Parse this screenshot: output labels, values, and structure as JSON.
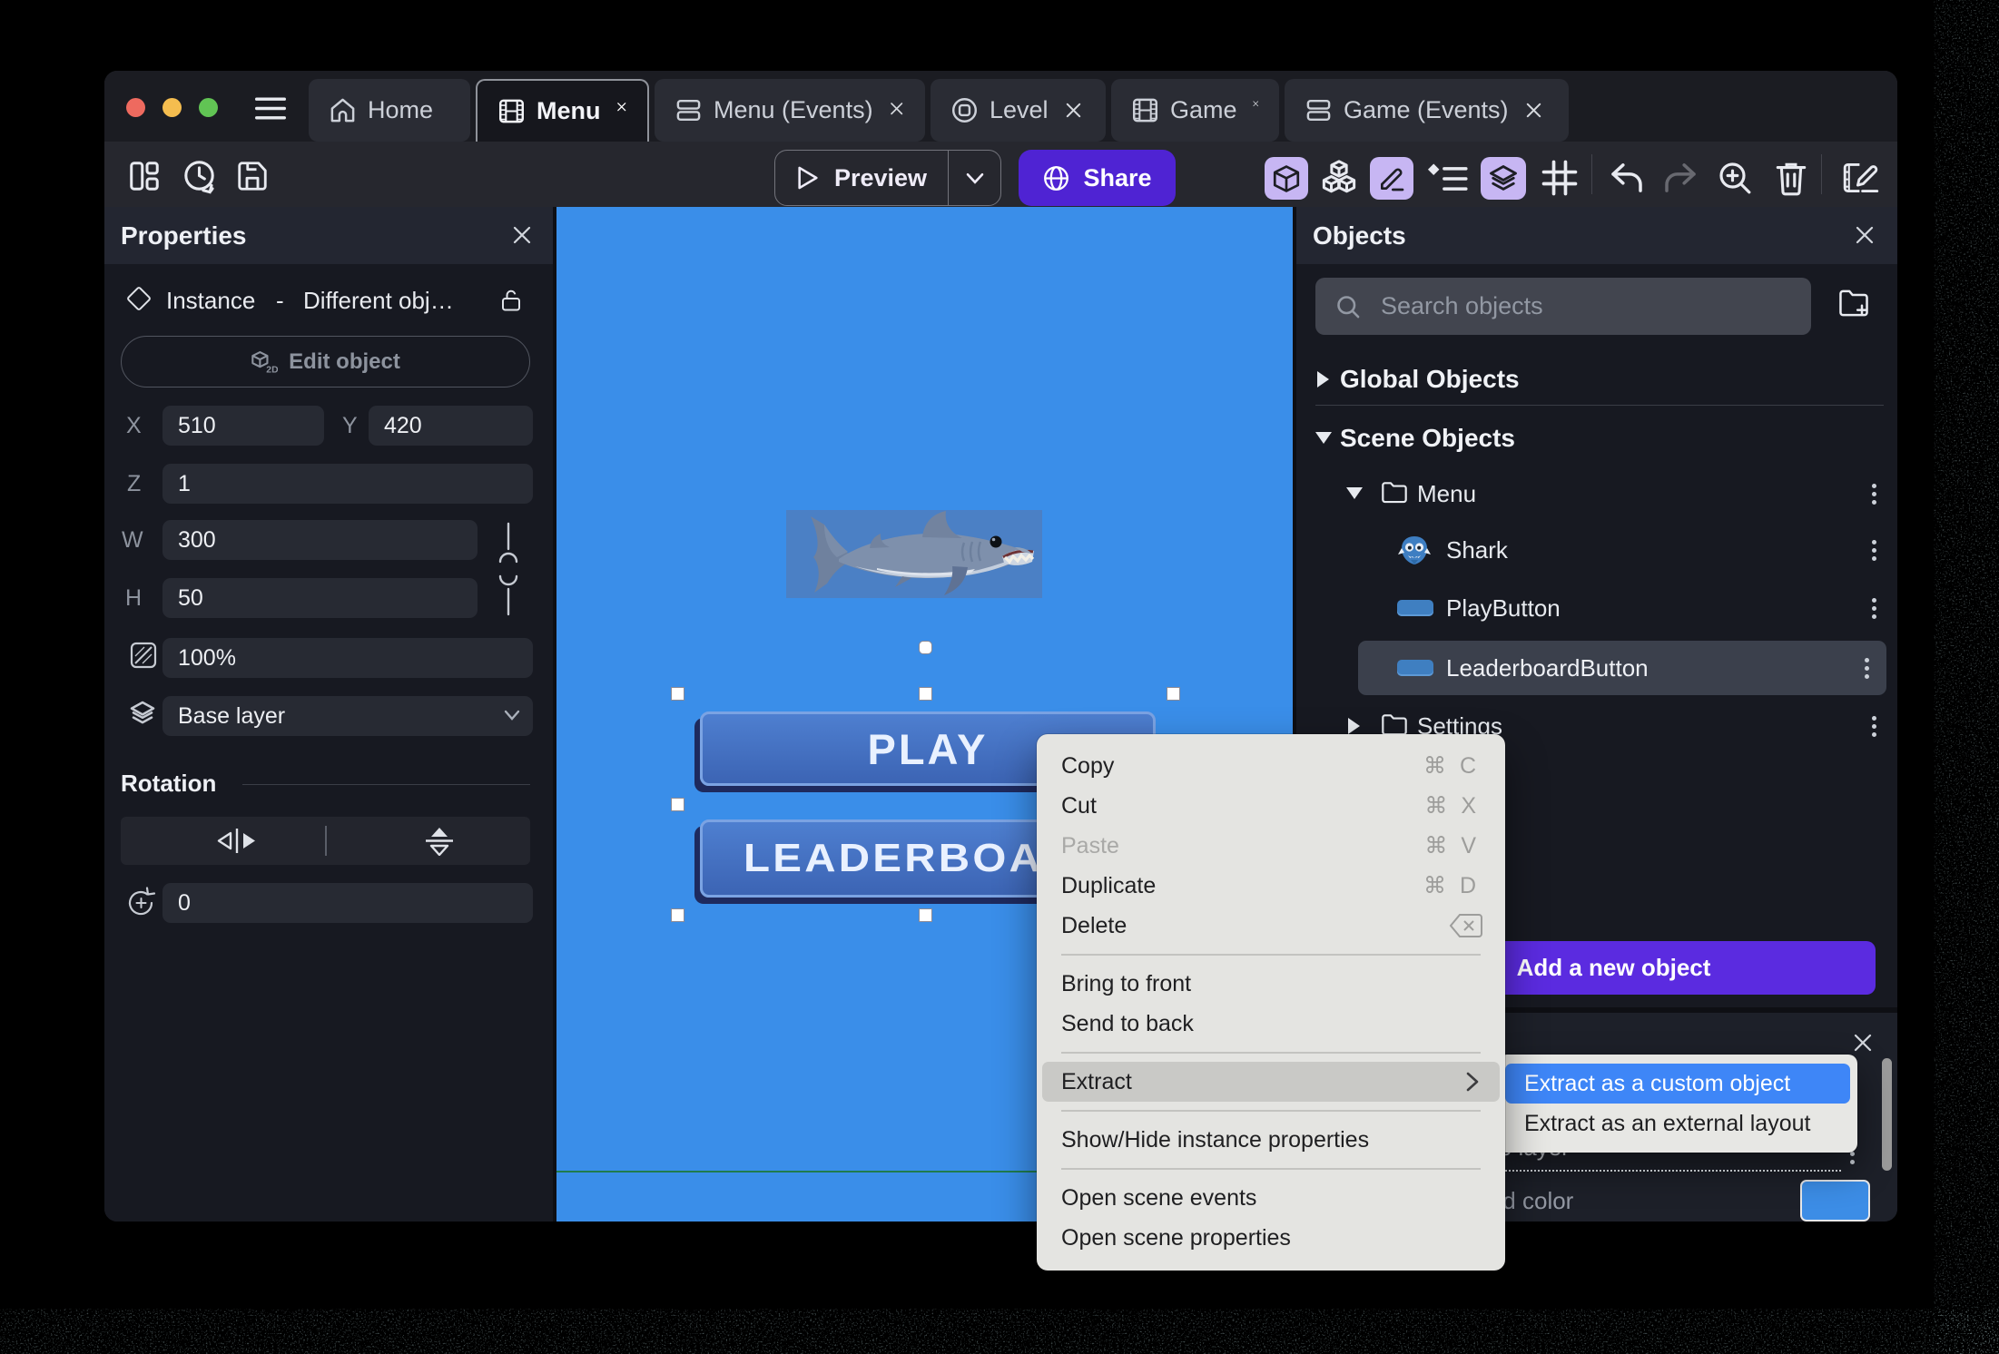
{
  "app": "GDevelop scene editor window (macOS)",
  "titlebar": {
    "tabs": [
      {
        "label": "Home",
        "icon": "home",
        "active": false,
        "closable": false
      },
      {
        "label": "Menu",
        "icon": "scene",
        "active": true,
        "closable": true
      },
      {
        "label": "Menu (Events)",
        "icon": "events",
        "active": false,
        "closable": true
      },
      {
        "label": "Level",
        "icon": "external-layout",
        "active": false,
        "closable": true
      },
      {
        "label": "Game",
        "icon": "scene",
        "active": false,
        "closable": true
      },
      {
        "label": "Game (Events)",
        "icon": "events",
        "active": false,
        "closable": true
      }
    ]
  },
  "toolbar": {
    "preview_label": "Preview",
    "share_label": "Share",
    "left_icons": [
      "panels-layout",
      "history",
      "save"
    ],
    "right_icons": [
      "object-cube-active",
      "blocks",
      "pen-active",
      "instruction-list",
      "layers-active",
      "grid",
      "undo",
      "redo-disabled",
      "zoom-in",
      "trash",
      "edit-scene"
    ]
  },
  "properties_panel": {
    "title": "Properties",
    "instance_label": "Instance",
    "instance_dash": "-",
    "instance_object": "Different obj…",
    "edit_object_label": "Edit object",
    "fields": {
      "x_label": "X",
      "x_value": "510",
      "y_label": "Y",
      "y_value": "420",
      "z_label": "Z",
      "z_value": "1",
      "w_label": "W",
      "w_value": "300",
      "h_label": "H",
      "h_value": "50",
      "opacity_value": "100%",
      "layer_value": "Base layer"
    },
    "rotation_title": "Rotation",
    "rotation_value": "0"
  },
  "canvas": {
    "background_color": "#3a8ee9",
    "play_button_label": "PLAY",
    "leaderboard_button_label": "LEADERBOARD",
    "selected_instances": 2
  },
  "objects_panel": {
    "title": "Objects",
    "search_placeholder": "Search objects",
    "global_section": "Global Objects",
    "scene_section": "Scene Objects",
    "folder_menu": "Menu",
    "item_shark": "Shark",
    "item_playbutton": "PlayButton",
    "item_leaderboardbutton": "LeaderboardButton",
    "folder_settings": "Settings",
    "add_button_label": "Add a new object",
    "selected_item": "LeaderboardButton"
  },
  "layers_panel": {
    "base_layer_label": "Base layer",
    "background_color_label": "Background color",
    "swatch_color": "#3c8de6"
  },
  "context_menu": {
    "items": [
      {
        "label": "Copy",
        "shortcut": "⌘ C"
      },
      {
        "label": "Cut",
        "shortcut": "⌘ X"
      },
      {
        "label": "Paste",
        "shortcut": "⌘ V",
        "disabled": true
      },
      {
        "label": "Duplicate",
        "shortcut": "⌘ D"
      },
      {
        "label": "Delete",
        "shortcut_icon": "clear-key"
      },
      {
        "label": "Bring to front"
      },
      {
        "label": "Send to back"
      },
      {
        "label": "Extract",
        "submenu": true,
        "highlighted": true
      },
      {
        "label": "Show/Hide instance properties"
      },
      {
        "label": "Open scene events"
      },
      {
        "label": "Open scene properties"
      }
    ]
  },
  "extract_submenu": {
    "items": [
      {
        "label": "Extract as a custom object",
        "selected": true
      },
      {
        "label": "Extract as an external layout",
        "selected": false
      }
    ]
  },
  "colors": {
    "accent_purple": "#5b2be0",
    "share_purple": "#4f23d3",
    "toolbar_toggle_purple": "#c7b6f3",
    "canvas_blue": "#3a8ee9",
    "menu_selection_blue": "#3e86f7",
    "traffic_red": "#ee6a5f",
    "traffic_yellow": "#f5bd4f",
    "traffic_green": "#61c454",
    "scene_bound_green": "#1f7b4e",
    "game_button_blue": "#4e7fd0"
  }
}
